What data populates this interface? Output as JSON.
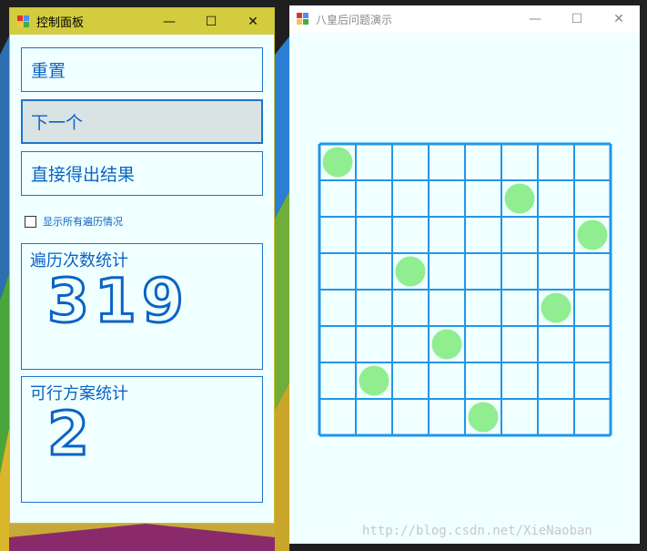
{
  "colors": {
    "accent": "#0b63c4",
    "grid": "#2196e8",
    "queen": "#90ee90",
    "panel_bg": "#f0ffff",
    "left_titlebar": "#d4cc3f"
  },
  "control_panel": {
    "title": "控制面板",
    "caption": {
      "minimize": "—",
      "maximize": "☐",
      "close": "✕"
    },
    "reset_label": "重置",
    "next_label": "下一个",
    "result_label": "直接得出结果",
    "show_all_label": "显示所有遍历情况",
    "traverse_title": "遍历次数统计",
    "traverse_count": "319",
    "solution_title": "可行方案统计",
    "solution_count": "2"
  },
  "queens_window": {
    "title": "八皇后问题演示",
    "caption": {
      "minimize": "—",
      "maximize": "☐",
      "close": "✕"
    },
    "board": {
      "size": 8,
      "queens": [
        0,
        5,
        7,
        2,
        6,
        3,
        1,
        4
      ]
    }
  },
  "watermark": "http://blog.csdn.net/XieNaoban"
}
